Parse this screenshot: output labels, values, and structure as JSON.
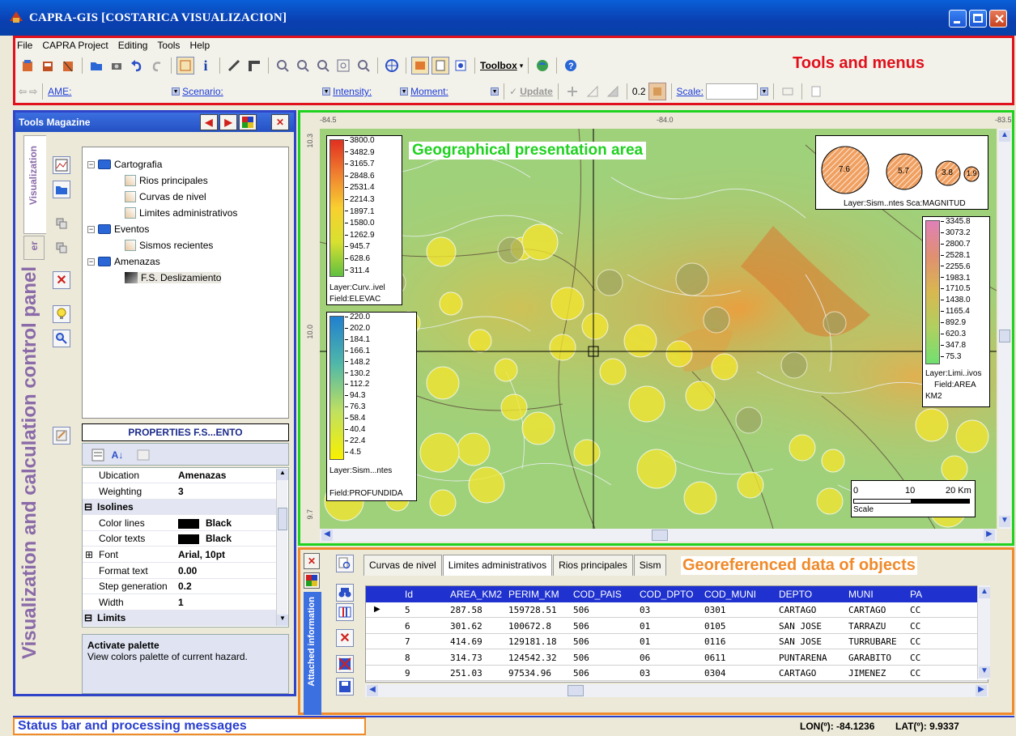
{
  "window": {
    "title": "CAPRA-GIS [COSTARICA VISUALIZACION]"
  },
  "menu": [
    "File",
    "CAPRA Project",
    "Editing",
    "Tools",
    "Help"
  ],
  "toolbar": {
    "toolbox_label": "Toolbox",
    "ame_label": "AME:",
    "scenario_label": "Scenario:",
    "intensity_label": "Intensity:",
    "moment_label": "Moment:",
    "update_label": "Update",
    "opacity_value": "0.2",
    "scale_label": "Scale:"
  },
  "annotations": {
    "tools": "Tools and menus",
    "map": "Geographical presentation area",
    "panel": "Visualization and calculation control panel",
    "data": "Georeferenced data of objects",
    "status": "Status bar and processing messages"
  },
  "left_panel": {
    "title": "Tools Magazine",
    "tab_visualization": "Visualization",
    "tab_other": "er",
    "tree": [
      {
        "label": "Cartografia",
        "kind": "folder",
        "level": 0
      },
      {
        "label": "Rios principales",
        "kind": "layer",
        "level": 1
      },
      {
        "label": "Curvas de nivel",
        "kind": "layer",
        "level": 1
      },
      {
        "label": "Limites administrativos",
        "kind": "layer",
        "level": 1
      },
      {
        "label": "Eventos",
        "kind": "folder",
        "level": 0
      },
      {
        "label": "Sismos recientes",
        "kind": "layer",
        "level": 1
      },
      {
        "label": "Amenazas",
        "kind": "folder",
        "level": 0
      },
      {
        "label": "F.S. Deslizamiento",
        "kind": "raster",
        "level": 1
      }
    ],
    "properties_title": "PROPERTIES F.S...ENTO",
    "properties": [
      {
        "k": "Ubication",
        "v": "Amenazas",
        "cat": false
      },
      {
        "k": "Weighting",
        "v": "3",
        "cat": false
      },
      {
        "k": "Isolines",
        "v": "",
        "cat": true
      },
      {
        "k": "Color lines",
        "v": "Black",
        "cat": false,
        "swatch": true
      },
      {
        "k": "Color texts",
        "v": "Black",
        "cat": false,
        "swatch": true
      },
      {
        "k": "Font",
        "v": "Arial, 10pt",
        "cat": false,
        "plus": true
      },
      {
        "k": "Format text",
        "v": "0.00",
        "cat": false
      },
      {
        "k": "Step generation",
        "v": "0.2",
        "cat": false
      },
      {
        "k": "Width",
        "v": "1",
        "cat": false
      },
      {
        "k": "Limits",
        "v": "",
        "cat": true
      }
    ],
    "description_title": "Activate palette",
    "description_text": "View colors palette of current hazard."
  },
  "map": {
    "ruler_top": [
      "-84.5",
      "-84.0",
      "-83.5"
    ],
    "ruler_left": [
      "10.3",
      "10.0",
      "9.7"
    ],
    "legend_elev": {
      "values": [
        "3800.0",
        "3482.9",
        "3165.7",
        "2848.6",
        "2531.4",
        "2214.3",
        "1897.1",
        "1580.0",
        "1262.9",
        "945.7",
        "628.6",
        "311.4"
      ],
      "layer": "Layer:Curv..ivel",
      "field": "Field:ELEVAC"
    },
    "legend_depth": {
      "values": [
        "220.0",
        "202.0",
        "184.1",
        "166.1",
        "148.2",
        "130.2",
        "112.2",
        "94.3",
        "76.3",
        "58.4",
        "40.4",
        "22.4",
        "4.5"
      ],
      "layer": "Layer:Sism...ntes",
      "field": "Field:PROFUNDIDA"
    },
    "legend_area": {
      "values": [
        "3345.8",
        "3073.2",
        "2800.7",
        "2528.1",
        "2255.6",
        "1983.1",
        "1710.5",
        "1438.0",
        "1165.4",
        "892.9",
        "620.3",
        "347.8",
        "75.3"
      ],
      "layer": "Layer:Limi..ivos",
      "field": "Field:AREA",
      "unit": "KM2"
    },
    "legend_mag": {
      "values": [
        "7.6",
        "5.7",
        "3.8",
        "1.9"
      ],
      "caption": "Layer:Sism..ntes Sca:MAGNITUD"
    },
    "scalebar": {
      "ticks": [
        "0",
        "10",
        "20 Km"
      ],
      "caption": "Scale"
    }
  },
  "data_panel": {
    "side_label": "Attached information",
    "tabs": [
      "Curvas de nivel",
      "Limites administrativos",
      "Rios principales",
      "Sism"
    ],
    "active_tab": 1,
    "columns": [
      "Id",
      "AREA_KM2",
      "PERIM_KM",
      "COD_PAIS",
      "COD_DPTO",
      "COD_MUNI",
      "DEPTO",
      "MUNI",
      "PA"
    ],
    "rows": [
      [
        "5",
        "287.58",
        "159728.51",
        "506",
        "03",
        "0301",
        "CARTAGO",
        "CARTAGO",
        "CC"
      ],
      [
        "6",
        "301.62",
        "100672.8",
        "506",
        "01",
        "0105",
        "SAN JOSE",
        "TARRAZU",
        "CC"
      ],
      [
        "7",
        "414.69",
        "129181.18",
        "506",
        "01",
        "0116",
        "SAN JOSE",
        "TURRUBARE",
        "CC"
      ],
      [
        "8",
        "314.73",
        "124542.32",
        "506",
        "06",
        "0611",
        "PUNTARENA",
        "GARABITO",
        "CC"
      ],
      [
        "9",
        "251.03",
        "97534.96",
        "506",
        "03",
        "0304",
        "CARTAGO",
        "JIMENEZ",
        "CC"
      ]
    ]
  },
  "status": {
    "lon": "LON(º): -84.1236",
    "lat": "LAT(º): 9.9337"
  }
}
